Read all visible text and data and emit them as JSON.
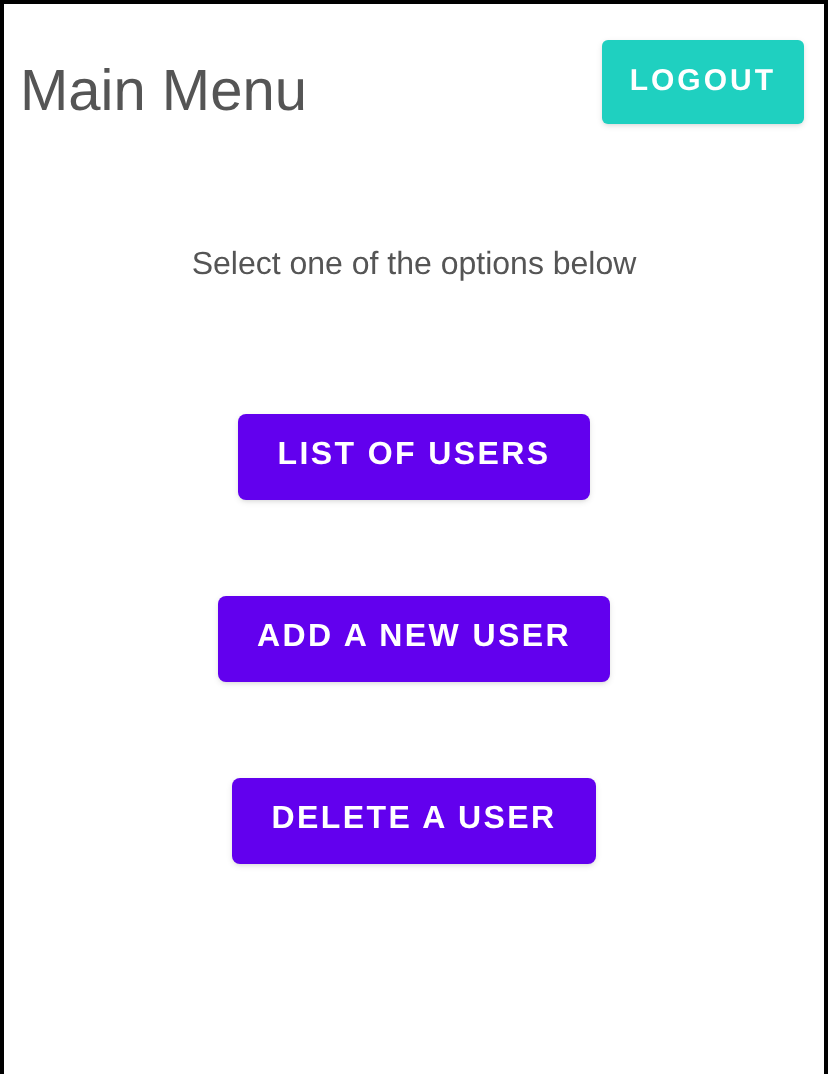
{
  "header": {
    "title": "Main Menu",
    "logout_button": "LOGOUT"
  },
  "prompt": "Select one of the options below",
  "buttons": [
    "LIST OF USERS",
    "ADD A NEW USER",
    "DELETE A USER"
  ]
}
